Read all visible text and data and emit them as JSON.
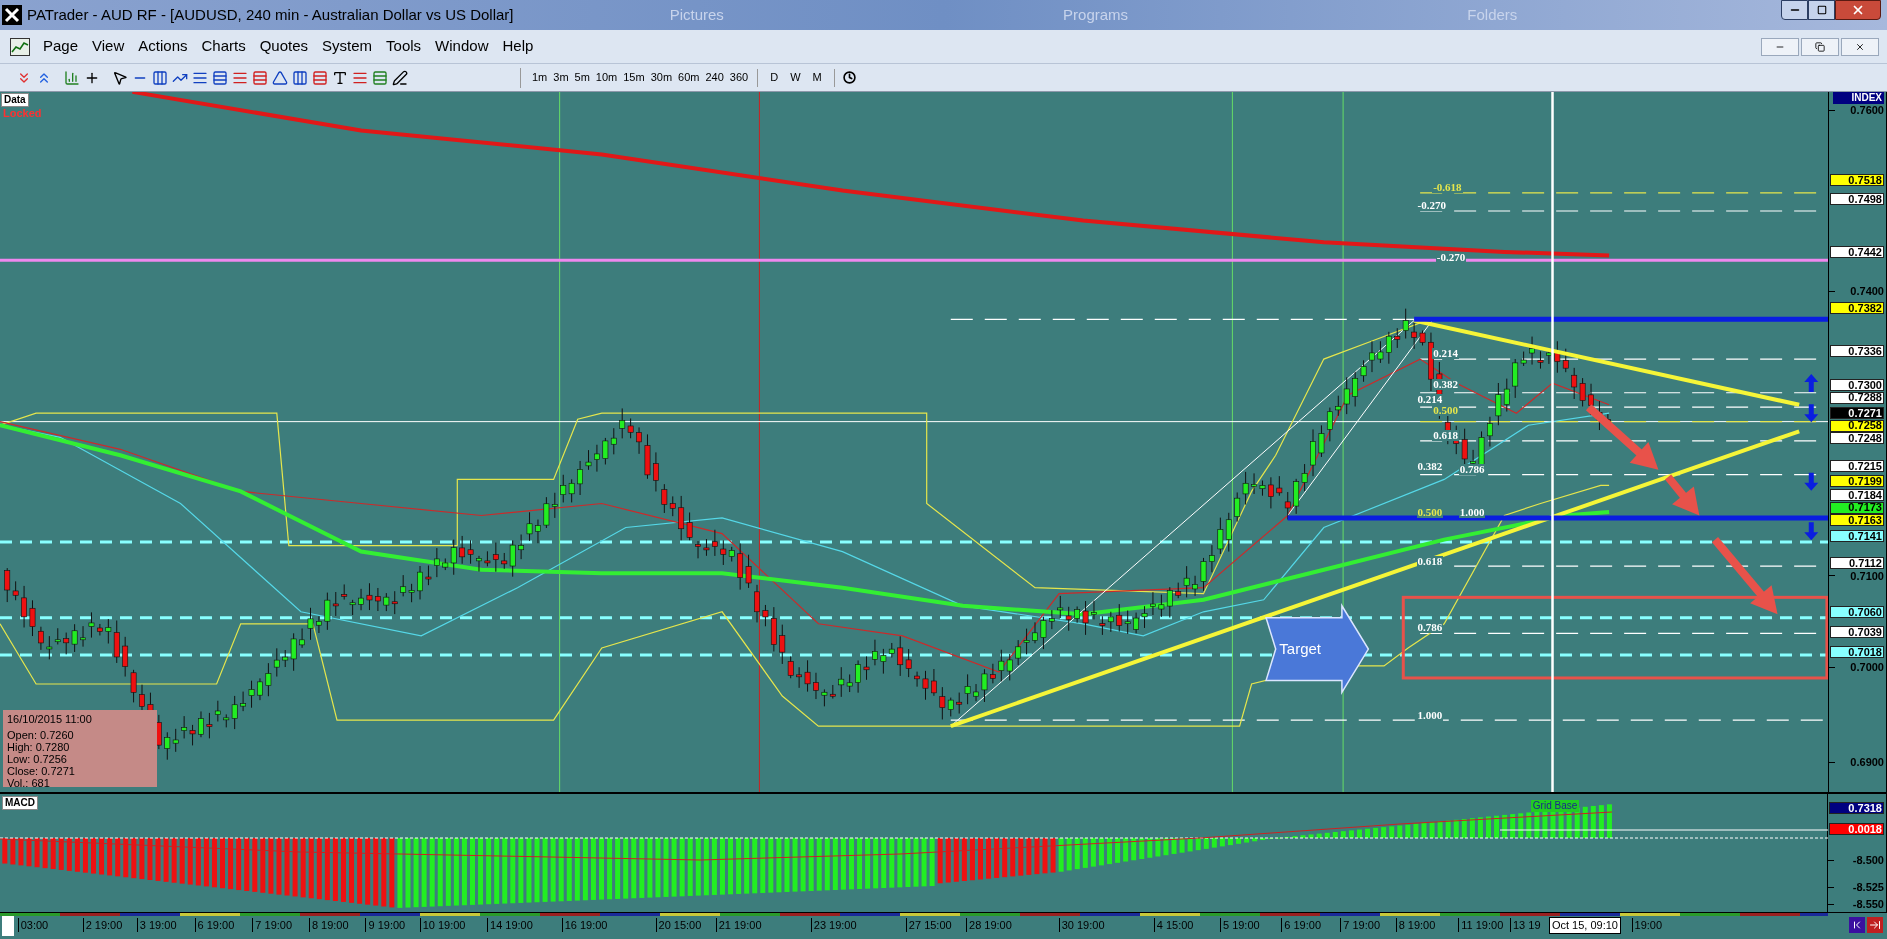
{
  "window": {
    "title": "PATrader - AUD RF - [AUDUSD, 240 min - Australian Dollar vs US Dollar]",
    "background_labels": [
      "Pictures",
      "Programs",
      "Folders"
    ]
  },
  "menu": [
    "Page",
    "View",
    "Actions",
    "Charts",
    "Quotes",
    "System",
    "Tools",
    "Window",
    "Help"
  ],
  "toolbar": {
    "timeframes": [
      "1m",
      "3m",
      "5m",
      "10m",
      "15m",
      "30m",
      "60m",
      "240",
      "360"
    ],
    "periods": [
      "D",
      "W",
      "M"
    ]
  },
  "chart": {
    "data_tag": "Data",
    "lock_status": "Locked",
    "index_label": "INDEX",
    "callout": "Target",
    "fib_labels": [
      {
        "text": "-0.618",
        "color": "#e6e64c"
      },
      {
        "text": "-0.270",
        "color": "#ffffff"
      },
      {
        "text": "-0.270",
        "color": "#ffffff"
      },
      {
        "text": "0.214",
        "color": "#ffffff"
      },
      {
        "text": "0.382",
        "color": "#ffffff"
      },
      {
        "text": "0.214",
        "color": "#ffffff"
      },
      {
        "text": "0.500",
        "color": "#e6e64c"
      },
      {
        "text": "0.618",
        "color": "#ffffff"
      },
      {
        "text": "0.382",
        "color": "#ffffff"
      },
      {
        "text": "0.786",
        "color": "#ffffff"
      },
      {
        "text": "0.500",
        "color": "#e6e64c"
      },
      {
        "text": "1.000",
        "color": "#ffffff"
      },
      {
        "text": "0.618",
        "color": "#ffffff"
      },
      {
        "text": "0.786",
        "color": "#ffffff"
      },
      {
        "text": "1.000",
        "color": "#ffffff"
      }
    ],
    "ohlc": {
      "title": "16/10/2015 11:00",
      "lines": [
        "Open: 0.7260",
        "High: 0.7280",
        "Low: 0.7256",
        "Close: 0.7271",
        "Vol.: 681"
      ]
    },
    "price_labels": [
      {
        "text": "0.7600",
        "kind": "tick"
      },
      {
        "text": "0.7518",
        "kind": "marker",
        "color": "#ffff00"
      },
      {
        "text": "0.7498",
        "kind": "marker",
        "color": "#ffffff"
      },
      {
        "text": "0.7442",
        "kind": "marker",
        "color": "#ffffff"
      },
      {
        "text": "0.7400",
        "kind": "tick"
      },
      {
        "text": "0.7382",
        "kind": "marker",
        "color": "#ffff00"
      },
      {
        "text": "0.7336",
        "kind": "marker",
        "color": "#ffffff"
      },
      {
        "text": "0.7300",
        "kind": "marker",
        "color": "#ffffff"
      },
      {
        "text": "0.7288",
        "kind": "marker",
        "color": "#ffffff"
      },
      {
        "text": "0.7271",
        "kind": "marker",
        "color": "#000000"
      },
      {
        "text": "0.7258",
        "kind": "marker",
        "color": "#ffff00"
      },
      {
        "text": "0.7248",
        "kind": "marker",
        "color": "#ffffff"
      },
      {
        "text": "0.7215",
        "kind": "marker",
        "color": "#ffffff"
      },
      {
        "text": "0.7199",
        "kind": "marker",
        "color": "#ffff00"
      },
      {
        "text": "0.7184",
        "kind": "marker",
        "color": "#ffffff"
      },
      {
        "text": "0.7173",
        "kind": "marker",
        "color": "#22ee22"
      },
      {
        "text": "0.7163",
        "kind": "marker",
        "color": "#ffff00"
      },
      {
        "text": "0.7141",
        "kind": "marker",
        "color": "#88ffff"
      },
      {
        "text": "0.7112",
        "kind": "marker",
        "color": "#ffffff"
      },
      {
        "text": "0.7100",
        "kind": "tick"
      },
      {
        "text": "0.7060",
        "kind": "marker",
        "color": "#88ffff"
      },
      {
        "text": "0.7039",
        "kind": "marker",
        "color": "#ffffff"
      },
      {
        "text": "0.7018",
        "kind": "marker",
        "color": "#88ffff"
      },
      {
        "text": "0.7000",
        "kind": "tick"
      },
      {
        "text": "0.6900",
        "kind": "tick"
      }
    ]
  },
  "macd": {
    "label": "MACD",
    "grid_tag": "Grid Base",
    "price_labels": [
      {
        "text": "0.7318",
        "kind": "marker",
        "color": "#000080"
      },
      {
        "text": "0.0018",
        "kind": "marker",
        "color": "#ff0000"
      },
      {
        "text": "-8.500",
        "kind": "tick"
      },
      {
        "text": "-8.525",
        "kind": "tick"
      },
      {
        "text": "-8.550",
        "kind": "tick"
      }
    ]
  },
  "time_axis": {
    "labels": [
      "03:00",
      "2 19:00",
      "3 19:00",
      "6 19:00",
      "7 19:00",
      "8 19:00",
      "9 19:00",
      "10 19:00",
      "14 19:00",
      "16 19:00",
      "20 15:00",
      "21 19:00",
      "23 19:00",
      "27 15:00",
      "28 19:00",
      "30 19:00",
      "4 15:00",
      "5 19:00",
      "6 19:00",
      "7 19:00",
      "8 19:00",
      "11 19:00",
      "13 19",
      "19:00"
    ],
    "cursor_label": "Oct 15, 09:10"
  }
}
